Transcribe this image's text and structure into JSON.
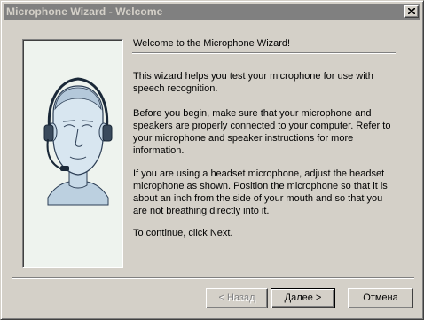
{
  "window": {
    "title": "Microphone Wizard - Welcome"
  },
  "content": {
    "heading": "Welcome to the Microphone Wizard!",
    "paragraphs": [
      "This wizard helps you test your microphone for use with speech recognition.",
      "Before you begin, make sure that your microphone and speakers are properly connected to your computer. Refer to your microphone and speaker instructions for more information.",
      "If you are using a headset microphone, adjust the headset microphone as shown. Position the microphone so that it is about an inch from the side of your mouth and so that you are not breathing directly into it.",
      "To continue, click Next."
    ]
  },
  "buttons": {
    "back_label": "< Назад",
    "next_label": "Далее >",
    "cancel_label": "Отмена"
  },
  "colors": {
    "titlebar_inactive": "#808080",
    "window_face": "#d4d0c8"
  },
  "icons": {
    "close": "close-icon",
    "illustration": "headset-head-illustration"
  }
}
